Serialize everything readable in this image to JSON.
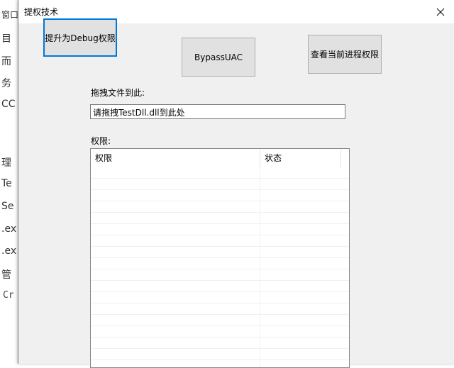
{
  "background_window": {
    "lines": [
      "窗口",
      "目",
      "而",
      "务",
      "CC",
      "理",
      "Te",
      "Se",
      ".ex",
      ".ex",
      "管",
      "Cr"
    ]
  },
  "dialog": {
    "title": "提权技术",
    "close_icon": "close-icon"
  },
  "buttons": {
    "debug": "提升为Debug权限",
    "bypass_uac": "BypassUAC",
    "view_privileges": "查看当前进程权限"
  },
  "drag": {
    "label": "拖拽文件到此:",
    "value": "请拖拽TestDll.dll到此处"
  },
  "privileges": {
    "label": "权限:",
    "columns": [
      "权限",
      "状态"
    ]
  },
  "colors": {
    "dialog_bg": "#f0f0f0",
    "focus_border": "#0078d7",
    "button_bg": "#e1e1e1"
  }
}
